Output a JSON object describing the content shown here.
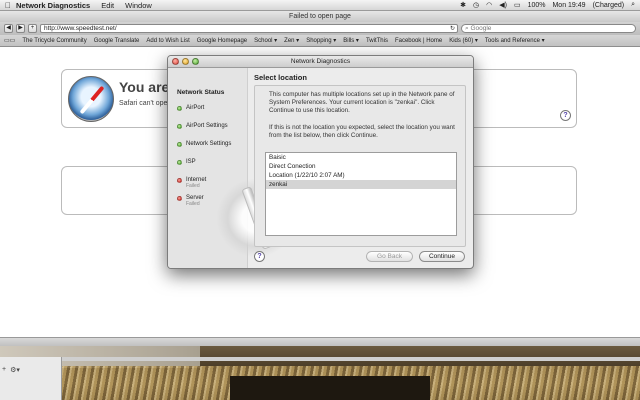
{
  "menubar": {
    "apple": "",
    "app_name": "Network Diagnostics",
    "menus": [
      "Edit",
      "Window"
    ],
    "status": {
      "time": "Mon 19:49",
      "battery": "(Charged)",
      "battery_pct": "100%"
    }
  },
  "browser": {
    "window_title": "Failed to open page",
    "url": "http://www.speedtest.net/",
    "search_placeholder": "Google",
    "bookmarks": [
      "The Tricycle Community",
      "Google Translate",
      "Add to Wish List",
      "Google Homepage",
      "School ▾",
      "Zen ▾",
      "Shopping ▾",
      "Bills ▾",
      "TwitThis",
      "Facebook | Home",
      "Kids (60) ▾",
      "Tools and Reference ▾"
    ],
    "error_title": "You are",
    "error_text": "Safari can't open"
  },
  "dialog": {
    "title": "Network Diagnostics",
    "sidebar_title": "Network Status",
    "steps": [
      {
        "label": "AirPort",
        "status": "ok",
        "sub": ""
      },
      {
        "label": "AirPort Settings",
        "status": "ok",
        "sub": ""
      },
      {
        "label": "Network Settings",
        "status": "ok",
        "sub": ""
      },
      {
        "label": "ISP",
        "status": "ok",
        "sub": ""
      },
      {
        "label": "Internet",
        "status": "fail",
        "sub": "Failed"
      },
      {
        "label": "Server",
        "status": "fail",
        "sub": "Failed"
      }
    ],
    "heading": "Select location",
    "para1": "This computer has multiple locations set up in the Network pane of System Preferences. Your current location is \"zenkai\". Click Continue to use this location.",
    "para2": "If this is not the location you expected, select the location you want from the list below, then click Continue.",
    "locations": [
      "Baisic",
      "Direct Conection",
      "Location (1/22/10 2:07 AM)",
      "zenkai"
    ],
    "selected_location": "zenkai",
    "back_label": "Go Back",
    "continue_label": "Continue",
    "help": "?"
  },
  "colors": {
    "ok": "#3c9a1f",
    "fail": "#c8201a",
    "selection": "#d4d4d4"
  }
}
